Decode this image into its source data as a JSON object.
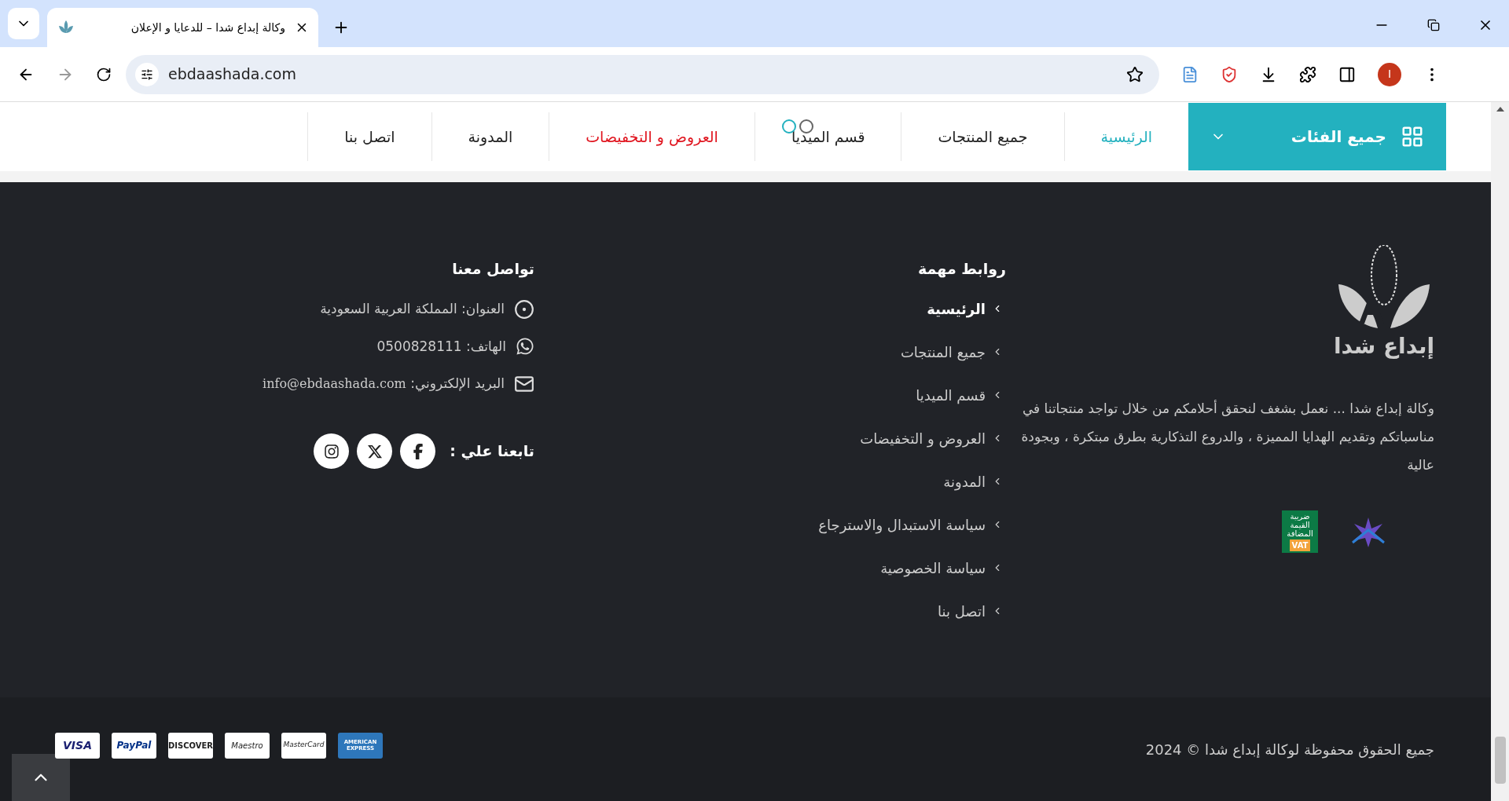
{
  "browser": {
    "tab_title": "وكالة إبداع شدا – للدعايا و الإعلان",
    "url": "ebdaashada.com",
    "profile_initial": "I"
  },
  "nav": {
    "categories_button": "جميع الفئات",
    "items": [
      {
        "label": "الرئيسية",
        "selected": true,
        "kind": "link"
      },
      {
        "label": "جميع المنتجات",
        "selected": false,
        "kind": "link"
      },
      {
        "label": "قسم الميديا",
        "selected": false,
        "kind": "loading"
      },
      {
        "label": "العروض و التخفيضات",
        "selected": false,
        "kind": "offer"
      },
      {
        "label": "المدونة",
        "selected": false,
        "kind": "link"
      },
      {
        "label": "اتصل بنا",
        "selected": false,
        "kind": "link"
      }
    ]
  },
  "about": {
    "logo_text": "إبداع شدا",
    "description": "وكالة إبداع شدا ... نعمل بشغف لنحقق أحلامكم من خلال تواجد منتجاتنا في مناسباتكم وتقديم الهدايا المميزة ، والدروع التذكارية بطرق مبتكرة ، وبجودة عالية",
    "vat_badge": {
      "lines": [
        "ضريبة",
        "القيمة",
        "المضافة"
      ],
      "tag": "VAT"
    }
  },
  "links": {
    "heading": "روابط مهمة",
    "items": [
      {
        "label": "الرئيسية",
        "selected": true
      },
      {
        "label": "جميع المنتجات",
        "selected": false
      },
      {
        "label": "قسم الميديا",
        "selected": false
      },
      {
        "label": "العروض و التخفيضات",
        "selected": false
      },
      {
        "label": "المدونة",
        "selected": false
      },
      {
        "label": "سياسة الاستبدال والاسترجاع",
        "selected": false
      },
      {
        "label": "سياسة الخصوصية",
        "selected": false
      },
      {
        "label": "اتصل بنا",
        "selected": false
      }
    ]
  },
  "contact": {
    "heading": "تواصل معنا",
    "items": [
      {
        "kind": "address",
        "text": "العنوان: المملكة العربية السعودية"
      },
      {
        "kind": "phone",
        "text": "الهاتف: 0500828111"
      },
      {
        "kind": "email",
        "label": "البريد الإلكتروني:",
        "value": "info@ebdaashada.com"
      }
    ],
    "follow_label": "تابعنا علي :",
    "socials": [
      {
        "kind": "facebook"
      },
      {
        "kind": "x"
      },
      {
        "kind": "instagram"
      }
    ]
  },
  "bottom": {
    "copyright": "جميع الحقوق محفوظة لوكالة إبداع شدا © 2024",
    "payments": [
      {
        "kind": "amex",
        "label": "AMERICAN EXPRESS"
      },
      {
        "kind": "mastercard",
        "label": "MasterCard"
      },
      {
        "kind": "maestro",
        "label": "Maestro"
      },
      {
        "kind": "discover",
        "label": "DISCOVER"
      },
      {
        "kind": "paypal",
        "label": "PayPal"
      },
      {
        "kind": "visa",
        "label": "VISA"
      }
    ]
  }
}
